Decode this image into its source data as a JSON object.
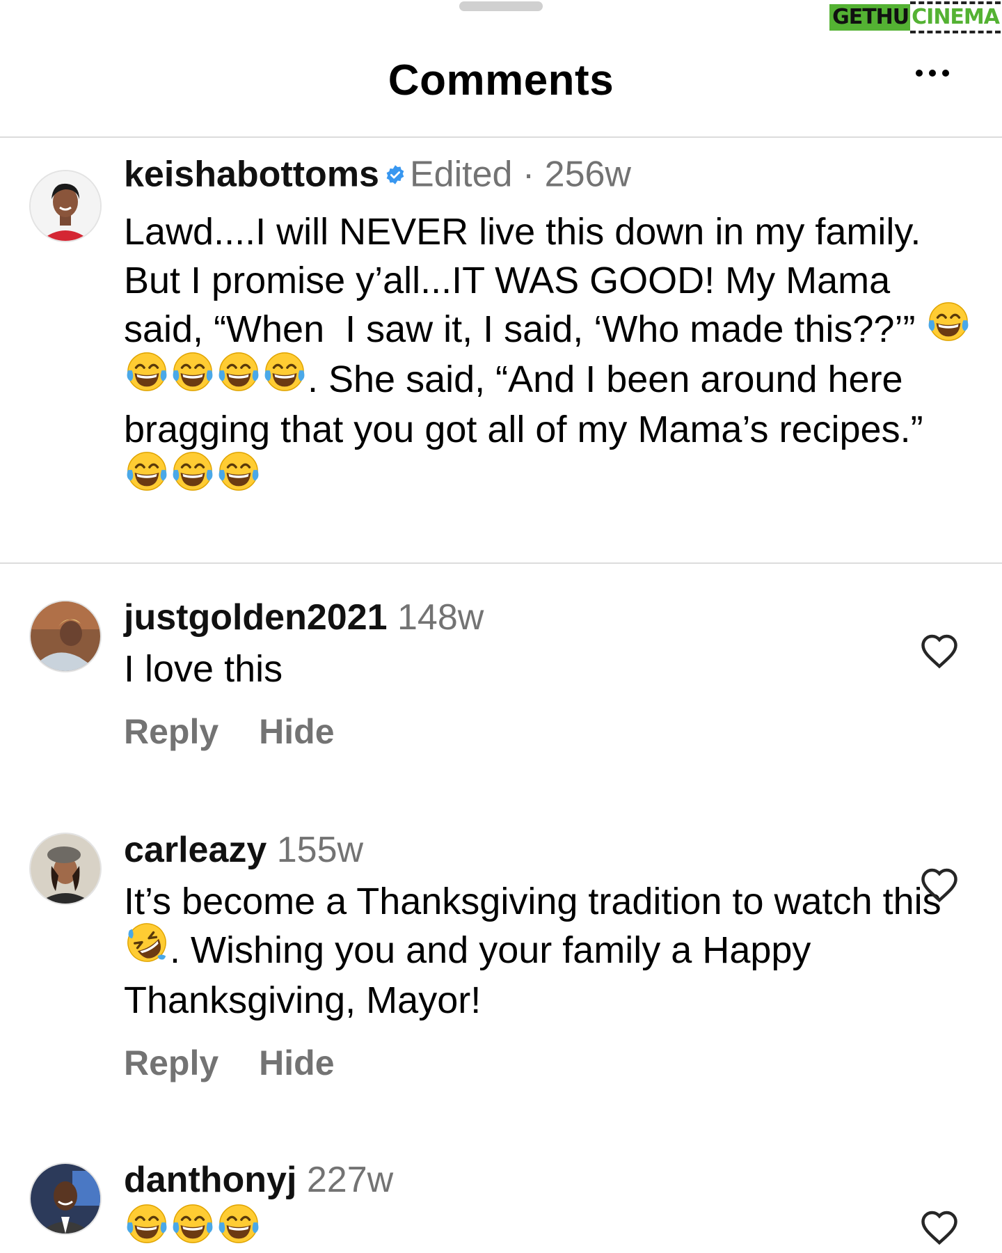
{
  "watermark": {
    "left_text": "GETHU",
    "right_text": "CINEMA"
  },
  "header": {
    "title": "Comments",
    "more_icon": "more-horizontal-icon"
  },
  "caption": {
    "username": "keishabottoms",
    "verified": true,
    "edited_label": "Edited",
    "separator": "·",
    "time": "256w",
    "text_parts": [
      "Lawd....I will NEVER live this down in my family. But I promise y’all...IT WAS GOOD! My Mama said, “When  I saw it, I said, ‘Who made this??’” ",
      ". She said, “And I been around here bragging that you got all of my Mama’s recipes.” "
    ],
    "emoji_group_1": [
      "face-with-tears-of-joy",
      "face-with-tears-of-joy",
      "face-with-tears-of-joy",
      "face-with-tears-of-joy",
      "face-with-tears-of-joy"
    ],
    "emoji_group_2": [
      "face-with-tears-of-joy",
      "face-with-tears-of-joy",
      "face-with-tears-of-joy"
    ]
  },
  "comments": [
    {
      "username": "justgolden2021",
      "time": "148w",
      "text_parts": [
        "I love this"
      ],
      "reply_label": "Reply",
      "hide_label": "Hide"
    },
    {
      "username": "carleazy",
      "time": "155w",
      "text_parts": [
        "It’s become a Thanksgiving tradition to watch this ",
        ". Wishing you and your family a Happy Thanksgiving, Mayor!"
      ],
      "emoji": [
        "rolling-on-the-floor-laughing"
      ],
      "reply_label": "Reply",
      "hide_label": "Hide"
    },
    {
      "username": "danthonyj",
      "time": "227w",
      "emoji": [
        "face-with-tears-of-joy",
        "face-with-tears-of-joy",
        "face-with-tears-of-joy"
      ]
    }
  ],
  "colors": {
    "verified_blue": "#3897f0",
    "secondary_text": "#737373",
    "divider": "#dcdcdc",
    "watermark_green": "#54b233"
  }
}
